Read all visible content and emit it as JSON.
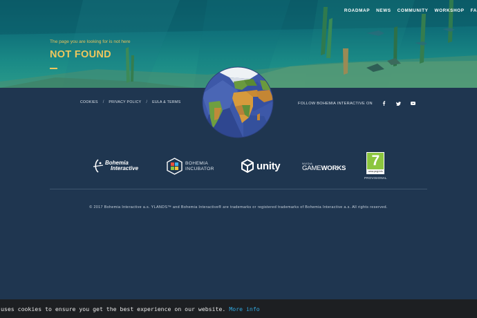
{
  "nav": {
    "items": [
      {
        "label": "ROADMAP"
      },
      {
        "label": "NEWS"
      },
      {
        "label": "COMMUNITY"
      },
      {
        "label": "WORKSHOP"
      },
      {
        "label": "FA"
      }
    ]
  },
  "error": {
    "message": "The page you are looking for is not here",
    "title": "NOT FOUND"
  },
  "legal": {
    "cookies": "COOKIES",
    "privacy": "PRIVACY POLICY",
    "eula": "EULA & TERMS",
    "separator": "/"
  },
  "follow": {
    "label": "FOLLOW BOHEMIA INTERACTIVE ON",
    "icons": [
      "facebook-icon",
      "twitter-icon",
      "youtube-icon"
    ]
  },
  "partners": {
    "bohemia": {
      "line1": "Bohemia",
      "line2": "Interactive"
    },
    "incubator": {
      "line1": "BOHEMIA",
      "line2": "INCUBATOR"
    },
    "unity": {
      "label": "unity"
    },
    "gameworks": {
      "vendor": "NVIDIA",
      "game": "GAME",
      "works": "WORKS"
    },
    "pegi": {
      "rating": "7",
      "url": "www.pegi.info",
      "status": "PROVISIONAL"
    }
  },
  "copyright": "© 2017 Bohemia Interactive a.s. YLANDS™ and Bohemia Interactive® are trademarks or registered trademarks of Bohemia Interactive a.s. All rights reserved.",
  "cookie": {
    "message": "uses cookies to ensure you get the best experience on our website.",
    "more": "More info"
  },
  "colors": {
    "accent": "#efc75d",
    "background": "#1f3650",
    "link": "#31a8e0",
    "cookie_bar": "#1d1f22"
  }
}
